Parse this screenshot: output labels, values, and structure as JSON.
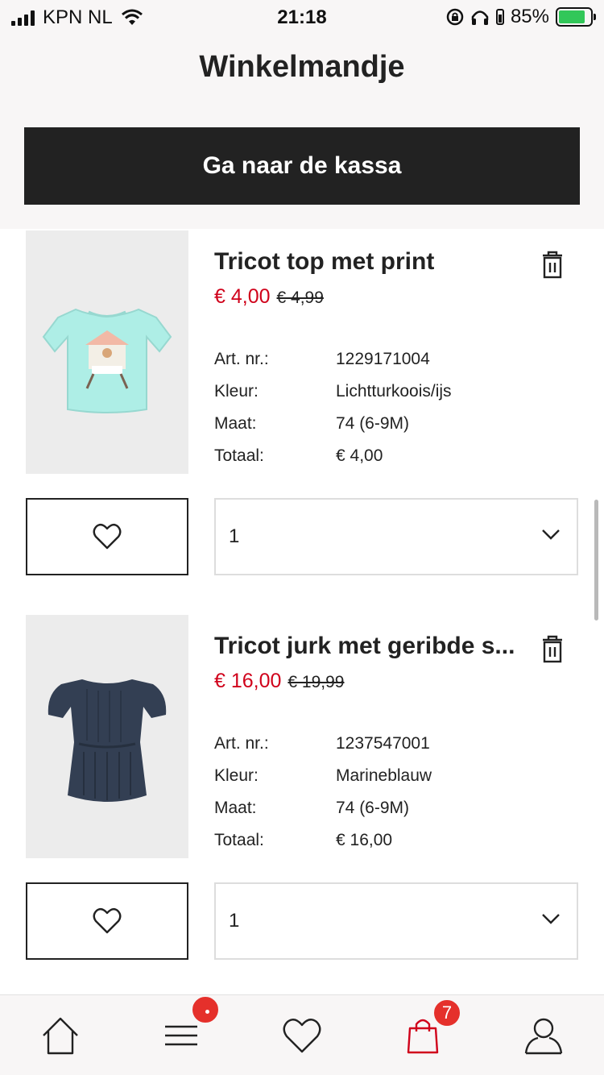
{
  "status_bar": {
    "carrier": "KPN NL",
    "time": "21:18",
    "battery_percent": "85%"
  },
  "header": {
    "title": "Winkelmandje",
    "checkout_label": "Ga naar de kassa"
  },
  "labels": {
    "art_nr": "Art. nr.:",
    "color": "Kleur:",
    "size": "Maat:",
    "total": "Totaal:"
  },
  "products": [
    {
      "title": "Tricot top met print",
      "price_now": "€ 4,00",
      "price_was": "€ 4,99",
      "art_nr": "1229171004",
      "color": "Lichtturkoois/ijs",
      "size": "74 (6-9M)",
      "total": "€ 4,00",
      "quantity": "1"
    },
    {
      "title": "Tricot jurk met geribde s...",
      "price_now": "€ 16,00",
      "price_was": "€ 19,99",
      "art_nr": "1237547001",
      "color": "Marineblauw",
      "size": "74 (6-9M)",
      "total": "€ 16,00",
      "quantity": "1"
    }
  ],
  "bottom_nav": {
    "items": [
      {
        "icon": "home-icon"
      },
      {
        "icon": "menu-icon",
        "badge": "dot"
      },
      {
        "icon": "heart-icon"
      },
      {
        "icon": "shopping-bag-icon",
        "badge_count": "7"
      },
      {
        "icon": "account-icon"
      }
    ]
  },
  "colors": {
    "sale_red": "#d0021b",
    "dark": "#222222",
    "badge_red": "#e5302b",
    "header_bg": "#f8f6f6"
  }
}
